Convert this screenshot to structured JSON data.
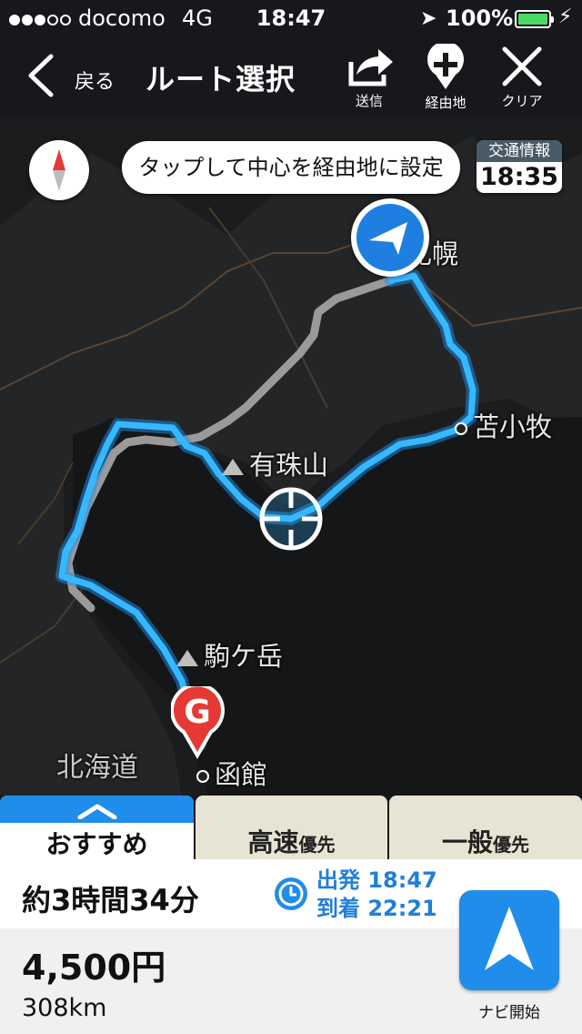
{
  "status_bar": {
    "carrier": "docomo",
    "network": "4G",
    "time": "18:47",
    "battery_percent": "100%",
    "battery_color": "#4cd964"
  },
  "nav": {
    "back_label": "戻る",
    "title": "ルート選択",
    "send_label": "送信",
    "waypoint_label": "経由地",
    "clear_label": "クリア"
  },
  "map": {
    "tap_hint": "タップして中心を経由地に設定",
    "traffic_label": "交通情報",
    "traffic_time": "18:35",
    "goal_marker": "G",
    "labels": {
      "sapporo": "札幌",
      "tomakomai": "苫小牧",
      "usuzan": "有珠山",
      "komagatake": "駒ケ岳",
      "hokkaido": "北海道",
      "hakodate": "函館"
    },
    "route_color": "#36b8ff",
    "alt_route_color": "#9a9a9a"
  },
  "tabs": [
    {
      "label": "おすすめ",
      "suffix": ""
    },
    {
      "label": "高速",
      "suffix": "優先"
    },
    {
      "label": "一般",
      "suffix": "優先"
    }
  ],
  "route": {
    "duration": "約3時間34分",
    "depart": "出発 18:47",
    "arrive": "到着 22:21",
    "price": "4,500円",
    "distance": "308km",
    "navi_label": "ナビ開始"
  }
}
